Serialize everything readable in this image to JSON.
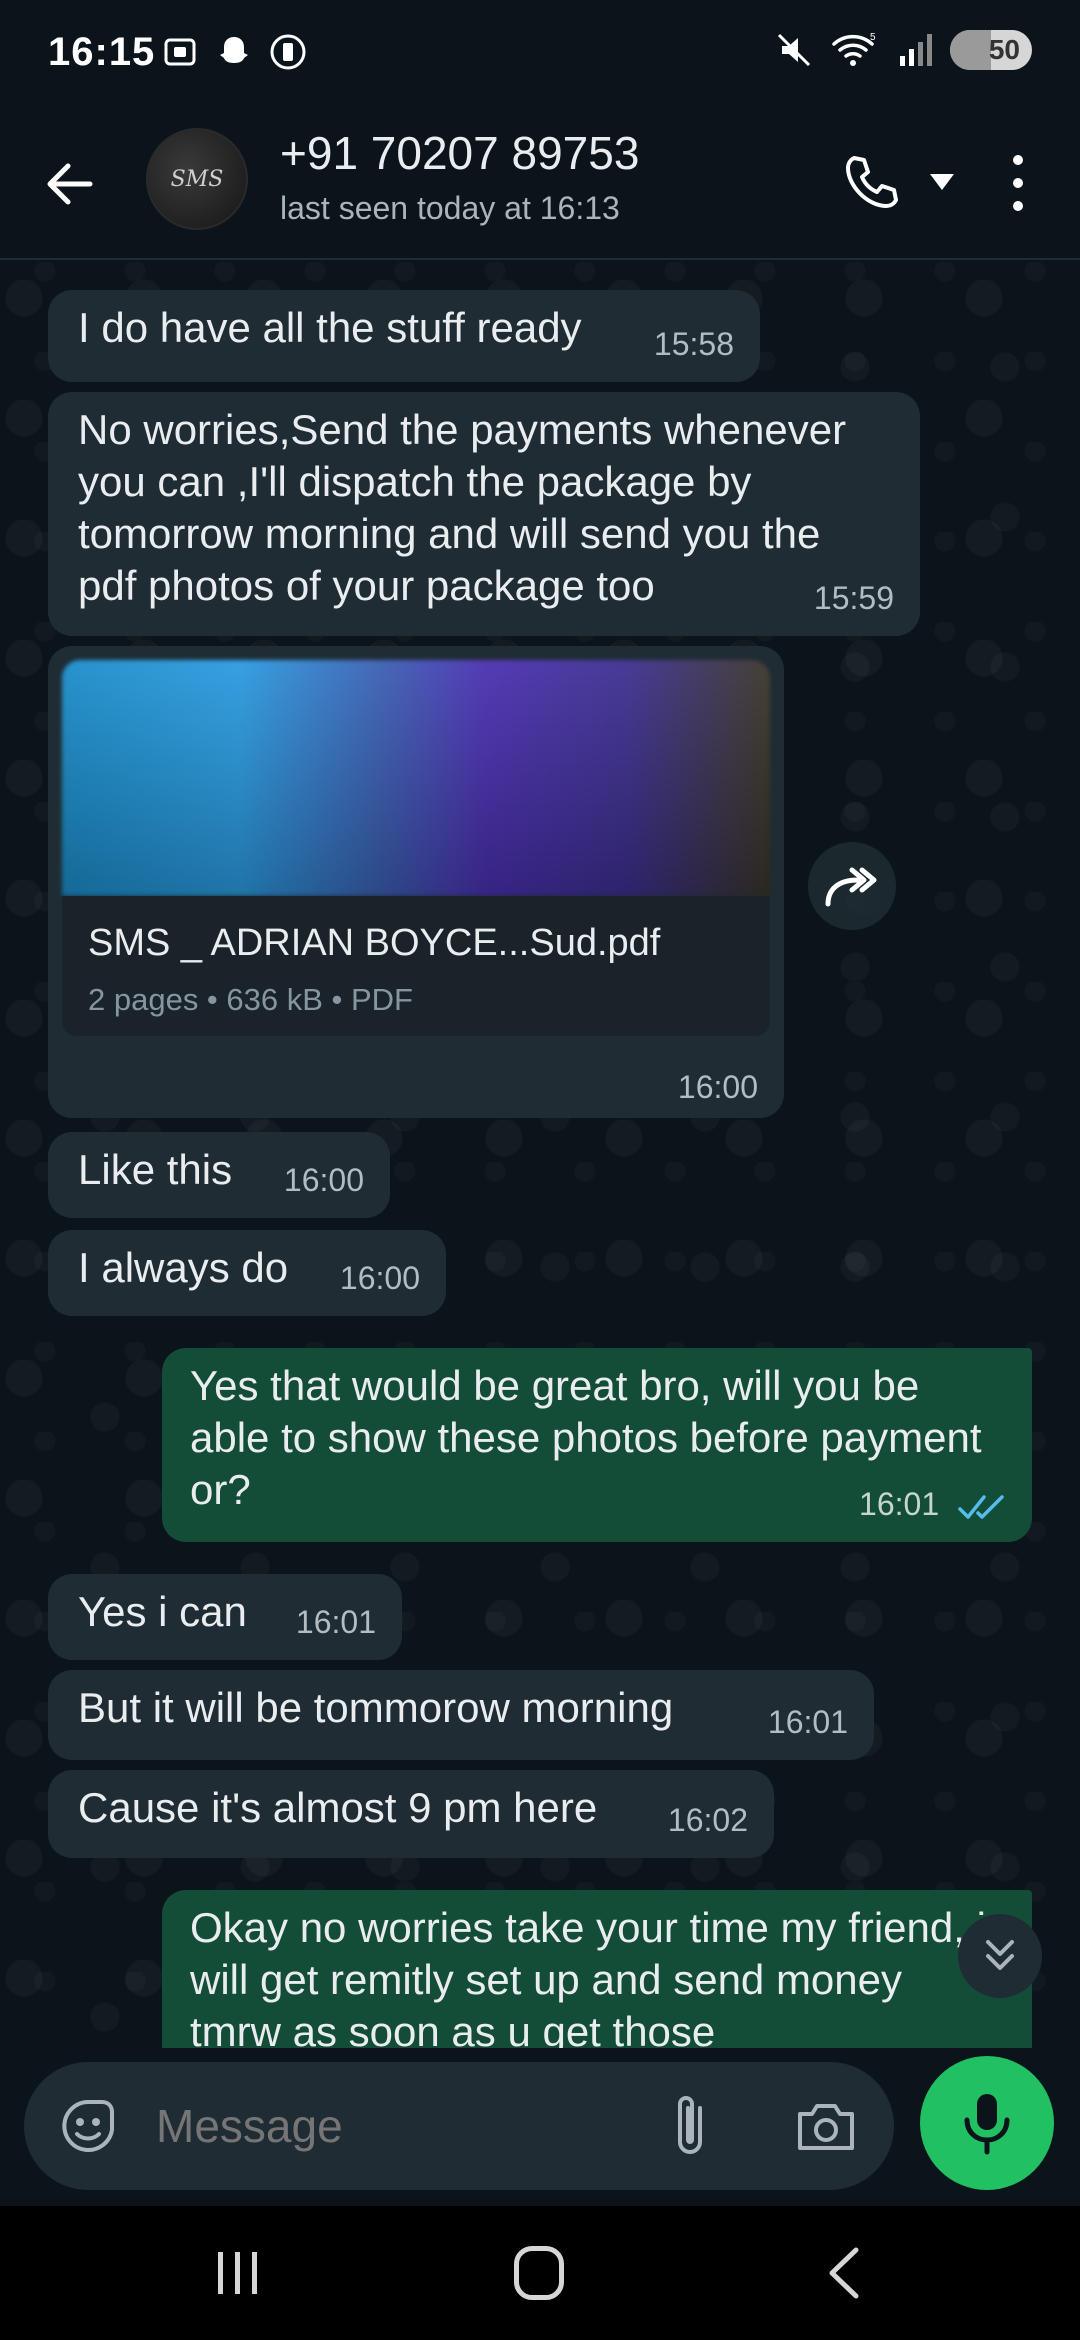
{
  "status_bar": {
    "time": "16:15",
    "battery": "50",
    "battery_level_percent": 50,
    "left_icons": [
      "screenshot-icon",
      "snapchat-icon",
      "battery-saver-icon"
    ],
    "right_icons": [
      "mute-icon",
      "wifi-icon",
      "signal-icon"
    ]
  },
  "header": {
    "contact_name": "+91 70207 89753",
    "last_seen": "last seen today at 16:13",
    "avatar_logo_text": "SMS",
    "icons": [
      "back-arrow-icon",
      "phone-icon",
      "caret-down-icon",
      "more-vert-icon"
    ]
  },
  "messages": [
    {
      "dir": "in",
      "text": "I do have all the stuff ready",
      "time": "15:58"
    },
    {
      "dir": "in",
      "text": "No worries,Send the payments whenever you can ,I'll dispatch the package by tomorrow morning and will send you the pdf photos of your package too",
      "time": "15:59"
    },
    {
      "dir": "in",
      "type": "document",
      "file_name": "SMS _ ADRIAN BOYCE...Sud.pdf",
      "meta": "2 pages • 636 kB • PDF",
      "time": "16:00"
    },
    {
      "dir": "in",
      "text": "Like this",
      "time": "16:00"
    },
    {
      "dir": "in",
      "text": "I always do",
      "time": "16:00"
    },
    {
      "dir": "out",
      "text": "Yes that would be great bro, will you be able to show these photos before payment or?",
      "time": "16:01",
      "status": "read"
    },
    {
      "dir": "in",
      "text": "Yes i can",
      "time": "16:01"
    },
    {
      "dir": "in",
      "text": "But it will be tommorow morning",
      "time": "16:01"
    },
    {
      "dir": "in",
      "text": "Cause it's almost 9 pm here",
      "time": "16:02"
    },
    {
      "dir": "out",
      "text": "Okay no worries take your time my friend, i will get remitly set up and send money tmrw as soon as u get those",
      "time": ""
    }
  ],
  "composer": {
    "placeholder": "Message",
    "icons": [
      "emoji-sticker-icon",
      "attach-icon",
      "camera-icon",
      "mic-icon"
    ]
  },
  "colors": {
    "background": "#0b141a",
    "incoming_bubble": "#1f2c33",
    "outgoing_bubble": "#144d37",
    "accent_green": "#21c063",
    "read_tick": "#53bdeb"
  }
}
